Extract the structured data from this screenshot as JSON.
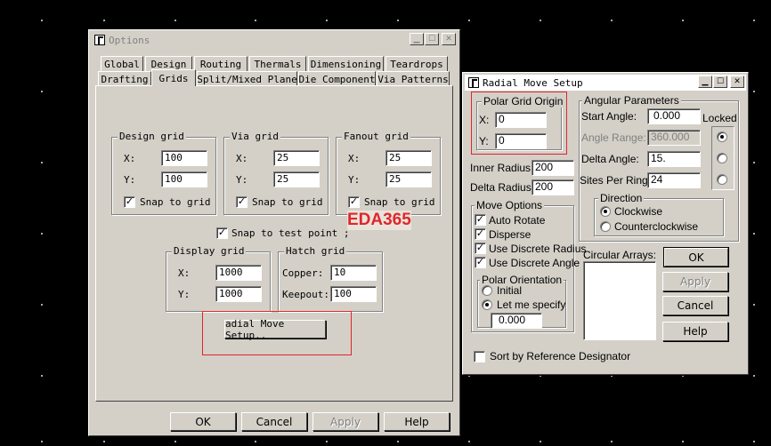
{
  "options": {
    "title": "Options",
    "tabs_row1": [
      "Global",
      "Design",
      "Routing",
      "Thermals",
      "Dimensioning",
      "Teardrops"
    ],
    "tabs_row2": [
      "Drafting",
      "Grids",
      "Split/Mixed Plane",
      "Die Component",
      "Via Patterns"
    ],
    "selected_tab": "Grids",
    "design_grid": {
      "title": "Design grid",
      "x_label": "X:",
      "x": "100",
      "y_label": "Y:",
      "y": "100",
      "snap_label": "Snap to grid",
      "snap": true
    },
    "via_grid": {
      "title": "Via grid",
      "x_label": "X:",
      "x": "25",
      "y_label": "Y:",
      "y": "25",
      "snap_label": "Snap to grid",
      "snap": true
    },
    "fanout_grid": {
      "title": "Fanout grid",
      "x_label": "X:",
      "x": "25",
      "y_label": "Y:",
      "y": "25",
      "snap_label": "Snap to grid",
      "snap": true
    },
    "snap_test_point_label": "Snap to test point ;",
    "snap_test_point": true,
    "display_grid": {
      "title": "Display grid",
      "x_label": "X:",
      "x": "1000",
      "y_label": "Y:",
      "y": "1000"
    },
    "hatch_grid": {
      "title": "Hatch grid",
      "copper_label": "Copper:",
      "copper": "10",
      "keepout_label": "Keepout:",
      "keepout": "100"
    },
    "radial_button": "adial Move Setup..",
    "watermark": "EDA365",
    "buttons": {
      "ok": "OK",
      "cancel": "Cancel",
      "apply": "Apply",
      "help": "Help"
    }
  },
  "radial": {
    "title": "Radial Move Setup",
    "polar_origin": {
      "title": "Polar Grid Origin",
      "x_label": "X:",
      "x": "0",
      "y_label": "Y:",
      "y": "0"
    },
    "inner_radius_label": "Inner Radius:",
    "inner_radius": "200",
    "delta_radius_label": "Delta Radius:",
    "delta_radius": "200",
    "angular": {
      "title": "Angular Parameters",
      "start_angle_label": "Start Angle:",
      "start_angle": "0.000",
      "angle_range_label": "Angle Range:",
      "angle_range": "360.000",
      "delta_angle_label": "Delta Angle:",
      "delta_angle": "15.",
      "sites_label": "Sites Per Ring:",
      "sites": "24",
      "locked_label": "Locked",
      "locked_selected": 0
    },
    "direction": {
      "title": "Direction",
      "clockwise": "Clockwise",
      "counterclockwise": "Counterclockwise",
      "selected": "clockwise"
    },
    "move_options": {
      "title": "Move Options",
      "items": [
        {
          "label": "Auto Rotate",
          "checked": true
        },
        {
          "label": "Disperse",
          "checked": true
        },
        {
          "label": "Use Discrete Radius",
          "checked": true
        },
        {
          "label": "Use Discrete Angle",
          "checked": true
        }
      ]
    },
    "polar_orientation": {
      "title": "Polar Orientation",
      "initial": "Initial",
      "let_me_specify": "Let me specify",
      "selected": "let_me_specify",
      "value": "0.000"
    },
    "circular_arrays_label": "Circular Arrays:",
    "sort_label": "Sort by Reference Designator",
    "sort_checked": false,
    "buttons": {
      "ok": "OK",
      "apply": "Apply",
      "cancel": "Cancel",
      "help": "Help"
    }
  },
  "colors": {
    "background": "#000000",
    "dialog": "#d4d0c8",
    "highlight_box": "#e0262b",
    "watermark": "#e0262b"
  }
}
